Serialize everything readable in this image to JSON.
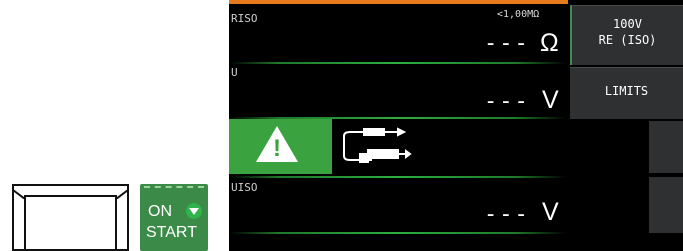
{
  "start_button": {
    "on_label": "ON",
    "start_label": "START"
  },
  "measurements": {
    "riso": {
      "label": "RISO",
      "range": "<1,00MΩ",
      "value": "---",
      "unit": "Ω"
    },
    "u": {
      "label": "U",
      "value": "---",
      "unit": "V"
    },
    "uiso": {
      "label": "UISO",
      "value": "---",
      "unit": "V"
    }
  },
  "softkeys": {
    "range_line1": "100V",
    "range_line2": "RE (ISO)",
    "limits": "LIMITS"
  },
  "icons": {
    "warning": "warning-triangle-icon",
    "probe": "test-probe-icon",
    "start": "start-triangle-icon"
  },
  "colors": {
    "accent_green": "#3aa33f",
    "orange_bar": "#e87a1e",
    "screen_bg": "#000000"
  }
}
